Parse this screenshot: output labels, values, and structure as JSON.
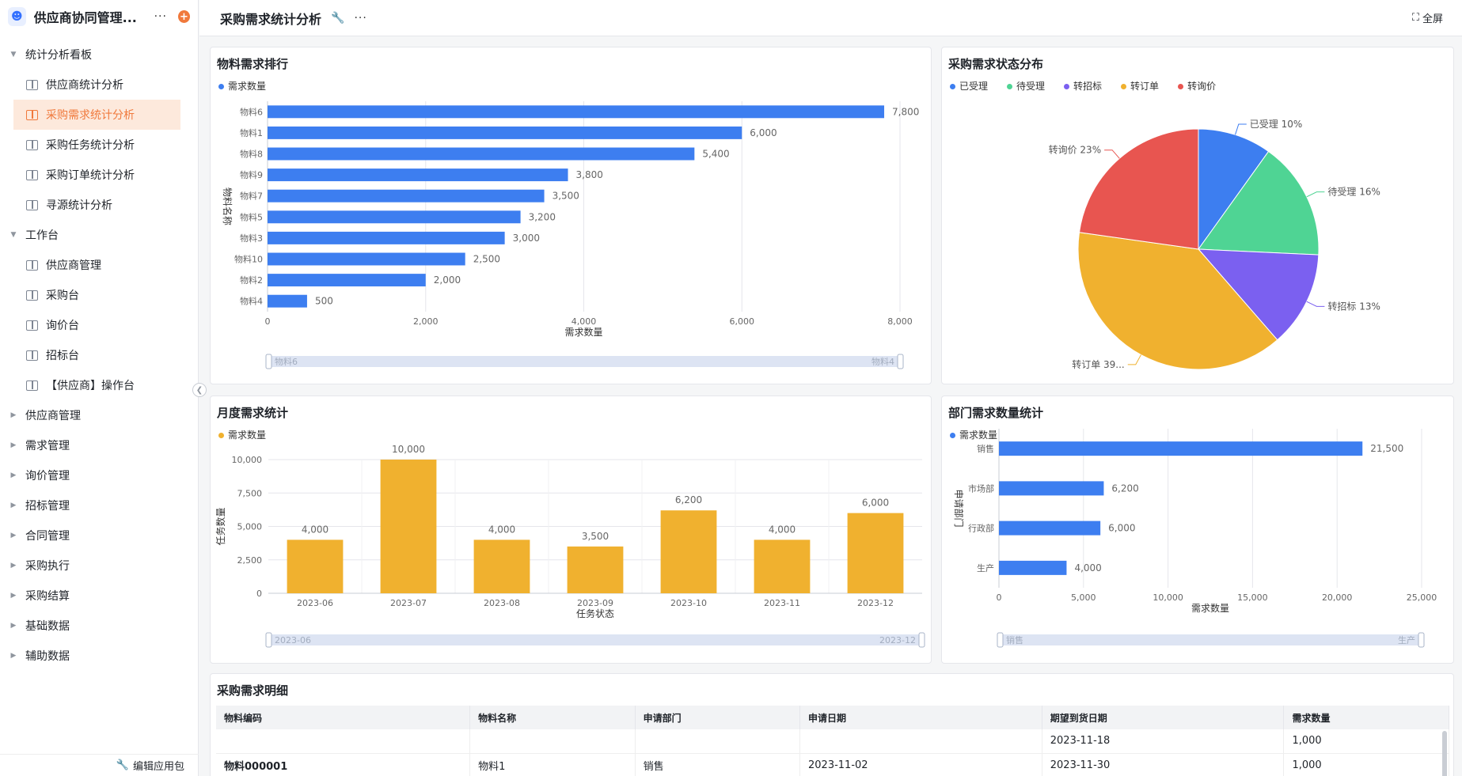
{
  "app": {
    "name": "供应商协同管理...",
    "edit_label": "编辑应用包"
  },
  "sidebar": {
    "groups": [
      {
        "label": "统计分析看板",
        "items": [
          "供应商统计分析",
          "采购需求统计分析",
          "采购任务统计分析",
          "采购订单统计分析",
          "寻源统计分析"
        ]
      },
      {
        "label": "工作台",
        "items": [
          "供应商管理",
          "采购台",
          "询价台",
          "招标台",
          "【供应商】操作台"
        ]
      }
    ],
    "collapsed": [
      "供应商管理",
      "需求管理",
      "询价管理",
      "招标管理",
      "合同管理",
      "采购执行",
      "采购结算",
      "基础数据",
      "辅助数据"
    ],
    "active": "采购需求统计分析"
  },
  "header": {
    "title": "采购需求统计分析",
    "fullscreen": "全屏"
  },
  "panels": {
    "rank": {
      "title": "物料需求排行"
    },
    "status": {
      "title": "采购需求状态分布"
    },
    "monthly": {
      "title": "月度需求统计"
    },
    "dept": {
      "title": "部门需求数量统计"
    },
    "detail": {
      "title": "采购需求明细"
    }
  },
  "colors": {
    "accent": "#f0793c",
    "blue": "#3d7ef0",
    "yellow": "#f0b12f",
    "green": "#4fd494",
    "purple": "#7b60f0",
    "red": "#e85550"
  },
  "chart_data": [
    {
      "type": "bar",
      "title": "物料需求排行",
      "orientation": "horizontal",
      "categories": [
        "物料6",
        "物料1",
        "物料8",
        "物料9",
        "物料7",
        "物料5",
        "物料3",
        "物料10",
        "物料2",
        "物料4"
      ],
      "series": [
        {
          "name": "需求数量",
          "values": [
            7800,
            6000,
            5400,
            3800,
            3500,
            3200,
            3000,
            2500,
            2000,
            500
          ]
        }
      ],
      "xlabel": "需求数量",
      "ylabel": "物料名称",
      "xticks": [
        "0",
        "2,000",
        "4,000",
        "6,000",
        "8,000"
      ],
      "xlim": [
        0,
        8000
      ],
      "slider": [
        "物料6",
        "物料4"
      ]
    },
    {
      "type": "pie",
      "title": "采购需求状态分布",
      "labels": [
        "已受理",
        "待受理",
        "转招标",
        "转订单",
        "转询价"
      ],
      "values": [
        10,
        16,
        13,
        39,
        23
      ],
      "slice_labels": [
        "已受理 10%",
        "待受理 16%",
        "转招标 13%",
        "转订单 39...",
        "转询价 23%"
      ]
    },
    {
      "type": "bar",
      "title": "月度需求统计",
      "categories": [
        "2023-06",
        "2023-07",
        "2023-08",
        "2023-09",
        "2023-10",
        "2023-11",
        "2023-12"
      ],
      "series": [
        {
          "name": "需求数量",
          "values": [
            4000,
            10000,
            4000,
            3500,
            6200,
            4000,
            6000
          ]
        }
      ],
      "xlabel": "任务状态",
      "ylabel": "任务数量",
      "yticks": [
        "0",
        "2,500",
        "5,000",
        "7,500",
        "10,000"
      ],
      "ylim": [
        0,
        10000
      ],
      "slider": [
        "2023-06",
        "2023-12"
      ]
    },
    {
      "type": "bar",
      "title": "部门需求数量统计",
      "orientation": "horizontal",
      "categories": [
        "销售",
        "市场部",
        "行政部",
        "生产"
      ],
      "series": [
        {
          "name": "需求数量",
          "values": [
            21500,
            6200,
            6000,
            4000
          ]
        }
      ],
      "xlabel": "需求数量",
      "ylabel": "申请部门",
      "xticks": [
        "0",
        "5,000",
        "10,000",
        "15,000",
        "20,000",
        "25,000"
      ],
      "xlim": [
        0,
        25000
      ],
      "slider": [
        "销售",
        "生产"
      ]
    }
  ],
  "table": {
    "columns": [
      "物料编码",
      "物料名称",
      "申请部门",
      "申请日期",
      "期望到货日期",
      "需求数量"
    ],
    "rows": [
      [
        "",
        "",
        "",
        "",
        "2023-11-18",
        "1,000"
      ],
      [
        "物料000001",
        "物料1",
        "销售",
        "2023-11-02",
        "2023-11-30",
        "1,000"
      ]
    ]
  }
}
